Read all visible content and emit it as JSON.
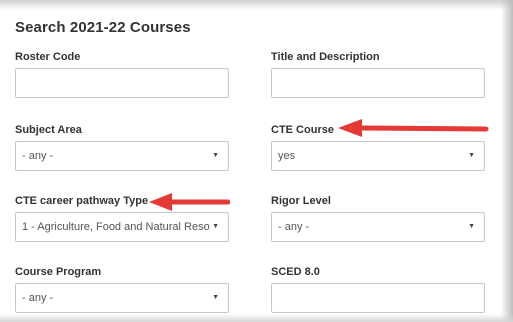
{
  "form": {
    "title": "Search 2021-22 Courses",
    "roster_code": {
      "label": "Roster Code",
      "value": ""
    },
    "title_description": {
      "label": "Title and Description",
      "value": ""
    },
    "subject_area": {
      "label": "Subject Area",
      "selected": "- any -"
    },
    "cte_course": {
      "label": "CTE Course",
      "selected": "yes"
    },
    "cte_pathway_type": {
      "label": "CTE career pathway Type",
      "selected": "1 - Agriculture, Food and Natural Reso"
    },
    "rigor_level": {
      "label": "Rigor Level",
      "selected": "- any -"
    },
    "course_program": {
      "label": "Course Program",
      "selected": "- any -"
    },
    "sced": {
      "label": "SCED 8.0",
      "value": ""
    }
  },
  "annotations": {
    "arrow_color": "#e53935"
  },
  "icons": {
    "dropdown": "caret-down-icon",
    "arrow": "red-arrow-icon"
  }
}
